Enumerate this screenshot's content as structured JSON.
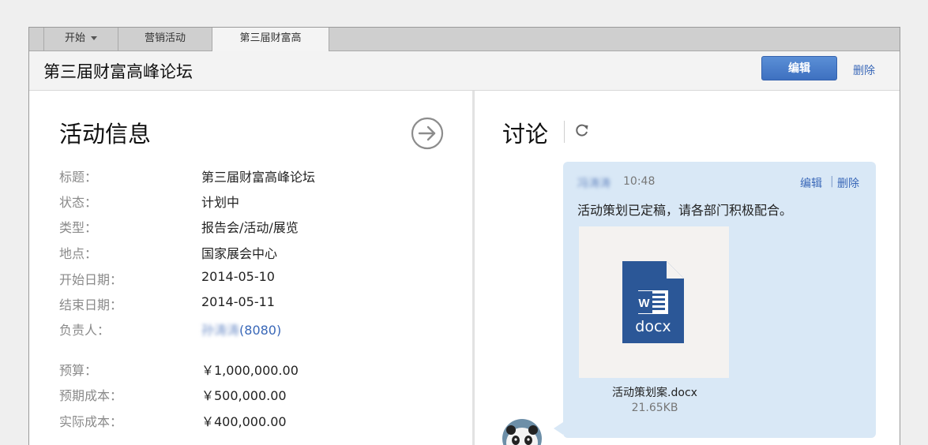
{
  "tabs": [
    {
      "label": "开始"
    },
    {
      "label": "营销活动"
    },
    {
      "label": "第三届财富高"
    }
  ],
  "header": {
    "title": "第三届财富高峰论坛",
    "edit_label": "编辑",
    "delete_label": "删除"
  },
  "info": {
    "section_title": "活动信息",
    "rows": [
      {
        "label": "标题：",
        "value": "第三届财富高峰论坛"
      },
      {
        "label": "状态：",
        "value": "计划中"
      },
      {
        "label": "类型：",
        "value": "报告会/活动/展览"
      },
      {
        "label": "地点：",
        "value": "国家展会中心"
      },
      {
        "label": "开始日期：",
        "value": "2014-05-10"
      },
      {
        "label": "结束日期：",
        "value": "2014-05-11"
      },
      {
        "label": "负责人：",
        "value_blurred": "孙涛涛",
        "value": "(8080)"
      },
      {
        "label": "预算：",
        "value": "￥1,000,000.00"
      },
      {
        "label": "预期成本：",
        "value": "￥500,000.00"
      },
      {
        "label": "实际成本：",
        "value": "￥400,000.00"
      }
    ]
  },
  "discussion": {
    "title": "讨论",
    "message": {
      "author_blurred": "冯涛涛",
      "time": "10:48",
      "edit_label": "编辑",
      "separator": "|",
      "delete_label": "删除",
      "text": "活动策划已定稿，请各部门积极配合。",
      "attachment": {
        "icon_text": "docx",
        "file_name": "活动策划案.docx",
        "file_size": "21.65KB"
      }
    }
  },
  "colors": {
    "accent": "#3e70c0",
    "link": "#3a68b8",
    "bubble": "#d9e8f6",
    "word_blue": "#2b5797"
  }
}
